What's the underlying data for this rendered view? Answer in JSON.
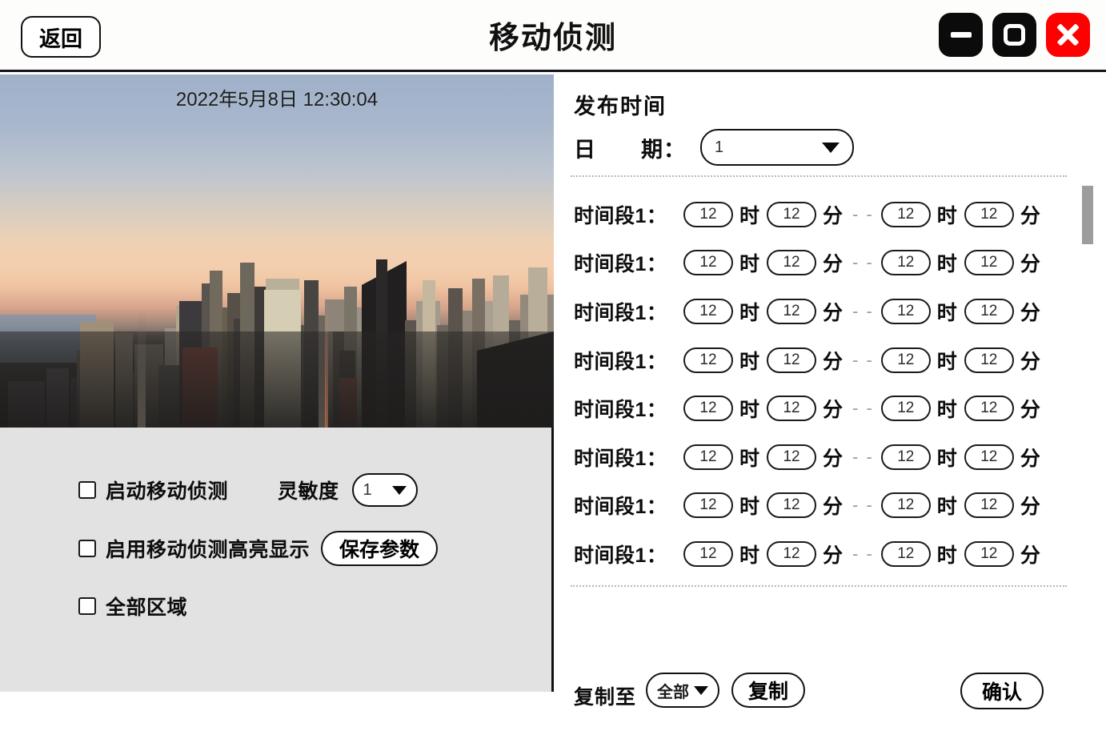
{
  "titlebar": {
    "back_label": "返回",
    "app_title": "移动侦测",
    "minimize_icon": "minimize-icon",
    "maximize_icon": "maximize-icon",
    "close_icon": "close-icon",
    "accent_close_color": "#fe0000"
  },
  "video": {
    "timestamp": "2022年5月8日 12:30:04",
    "scene": "city-skyline-at-dusk"
  },
  "left_controls": {
    "enable_motion": {
      "label": "启动移动侦测",
      "checked": false
    },
    "sensitivity": {
      "label": "灵敏度",
      "value": "1"
    },
    "enable_highlight": {
      "label": "启用移动侦测高亮显示",
      "checked": false
    },
    "save_params": {
      "label": "保存参数"
    },
    "all_area": {
      "label": "全部区域",
      "checked": false
    }
  },
  "right_panel": {
    "section_title": "发布时间",
    "date_label": "日　　期：",
    "date_value": "1",
    "units": {
      "hour": "时",
      "minute": "分"
    },
    "range_separator": "- -",
    "time_rows": [
      {
        "label": "时间段1：",
        "start_hour": "12",
        "start_minute": "12",
        "end_hour": "12",
        "end_minute": "12"
      },
      {
        "label": "时间段1：",
        "start_hour": "12",
        "start_minute": "12",
        "end_hour": "12",
        "end_minute": "12"
      },
      {
        "label": "时间段1：",
        "start_hour": "12",
        "start_minute": "12",
        "end_hour": "12",
        "end_minute": "12"
      },
      {
        "label": "时间段1：",
        "start_hour": "12",
        "start_minute": "12",
        "end_hour": "12",
        "end_minute": "12"
      },
      {
        "label": "时间段1：",
        "start_hour": "12",
        "start_minute": "12",
        "end_hour": "12",
        "end_minute": "12"
      },
      {
        "label": "时间段1：",
        "start_hour": "12",
        "start_minute": "12",
        "end_hour": "12",
        "end_minute": "12"
      },
      {
        "label": "时间段1：",
        "start_hour": "12",
        "start_minute": "12",
        "end_hour": "12",
        "end_minute": "12"
      },
      {
        "label": "时间段1：",
        "start_hour": "12",
        "start_minute": "12",
        "end_hour": "12",
        "end_minute": "12"
      }
    ],
    "footer": {
      "copy_to_label": "复制至",
      "copy_to_value": "全部",
      "copy_button": "复制",
      "confirm_button": "确认"
    }
  }
}
